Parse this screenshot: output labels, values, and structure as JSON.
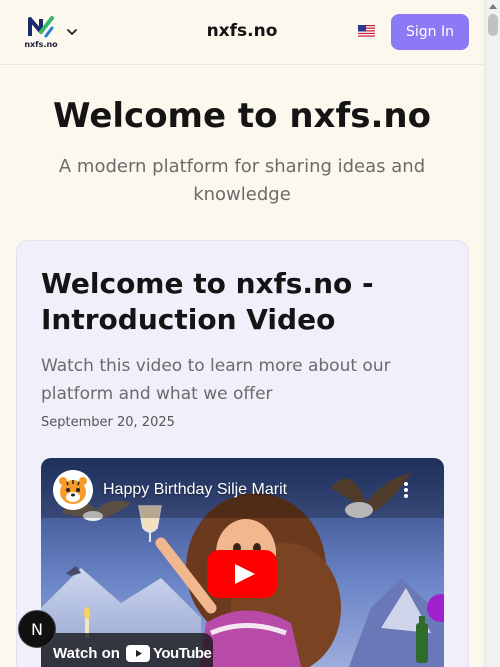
{
  "header": {
    "logo_text": "nxfs.no",
    "site_name": "nxfs.no",
    "language_flag_icon": "us-flag-icon",
    "signin_label": "Sign In"
  },
  "hero": {
    "title": "Welcome to nxfs.no",
    "subtitle": "A modern platform for sharing ideas and knowledge"
  },
  "post": {
    "title": "Welcome to nxfs.no - Introduction Video",
    "description": "Watch this video to learn more about our platform and what we offer",
    "date": "September 20, 2025",
    "video": {
      "title": "Happy Birthday Silje Marit",
      "watch_on_label": "Watch on",
      "platform": "YouTube"
    }
  },
  "dev_badge": {
    "label": "N"
  },
  "colors": {
    "background": "#fdf8ee",
    "accent": "#8b79f5",
    "card": "#f0effa"
  }
}
